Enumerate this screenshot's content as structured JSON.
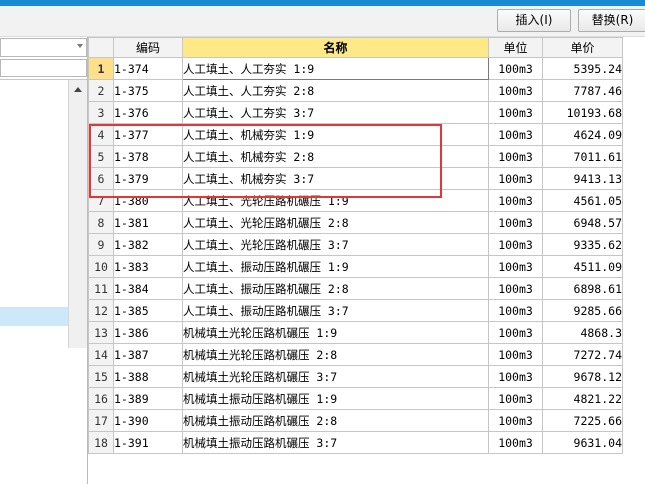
{
  "toolbar": {
    "insert_label": "插入(I)",
    "replace_label": "替换(R)"
  },
  "table": {
    "headers": {
      "code": "编码",
      "name": "名称",
      "unit": "单位",
      "price": "单价"
    },
    "rows": [
      {
        "index": "1",
        "code": "1-374",
        "name": "人工填土、人工夯实 1:9",
        "unit": "100m3",
        "price": "5395.24"
      },
      {
        "index": "2",
        "code": "1-375",
        "name": "人工填土、人工夯实 2:8",
        "unit": "100m3",
        "price": "7787.46"
      },
      {
        "index": "3",
        "code": "1-376",
        "name": "人工填土、人工夯实 3:7",
        "unit": "100m3",
        "price": "10193.68"
      },
      {
        "index": "4",
        "code": "1-377",
        "name": "人工填土、机械夯实 1:9",
        "unit": "100m3",
        "price": "4624.09"
      },
      {
        "index": "5",
        "code": "1-378",
        "name": "人工填土、机械夯实 2:8",
        "unit": "100m3",
        "price": "7011.61"
      },
      {
        "index": "6",
        "code": "1-379",
        "name": "人工填土、机械夯实 3:7",
        "unit": "100m3",
        "price": "9413.13"
      },
      {
        "index": "7",
        "code": "1-380",
        "name": "人工填土、光轮压路机碾压 1:9",
        "unit": "100m3",
        "price": "4561.05"
      },
      {
        "index": "8",
        "code": "1-381",
        "name": "人工填土、光轮压路机碾压 2:8",
        "unit": "100m3",
        "price": "6948.57"
      },
      {
        "index": "9",
        "code": "1-382",
        "name": "人工填土、光轮压路机碾压 3:7",
        "unit": "100m3",
        "price": "9335.62"
      },
      {
        "index": "10",
        "code": "1-383",
        "name": "人工填土、振动压路机碾压 1:9",
        "unit": "100m3",
        "price": "4511.09"
      },
      {
        "index": "11",
        "code": "1-384",
        "name": "人工填土、振动压路机碾压 2:8",
        "unit": "100m3",
        "price": "6898.61"
      },
      {
        "index": "12",
        "code": "1-385",
        "name": "人工填土、振动压路机碾压 3:7",
        "unit": "100m3",
        "price": "9285.66"
      },
      {
        "index": "13",
        "code": "1-386",
        "name": "机械填土光轮压路机碾压 1:9",
        "unit": "100m3",
        "price": "4868.3"
      },
      {
        "index": "14",
        "code": "1-387",
        "name": "机械填土光轮压路机碾压 2:8",
        "unit": "100m3",
        "price": "7272.74"
      },
      {
        "index": "15",
        "code": "1-388",
        "name": "机械填土光轮压路机碾压 3:7",
        "unit": "100m3",
        "price": "9678.12"
      },
      {
        "index": "16",
        "code": "1-389",
        "name": "机械填土振动压路机碾压 1:9",
        "unit": "100m3",
        "price": "4821.22"
      },
      {
        "index": "17",
        "code": "1-390",
        "name": "机械填土振动压路机碾压 2:8",
        "unit": "100m3",
        "price": "7225.66"
      },
      {
        "index": "18",
        "code": "1-391",
        "name": "机械填土振动压路机碾压 3:7",
        "unit": "100m3",
        "price": "9631.04"
      }
    ]
  }
}
